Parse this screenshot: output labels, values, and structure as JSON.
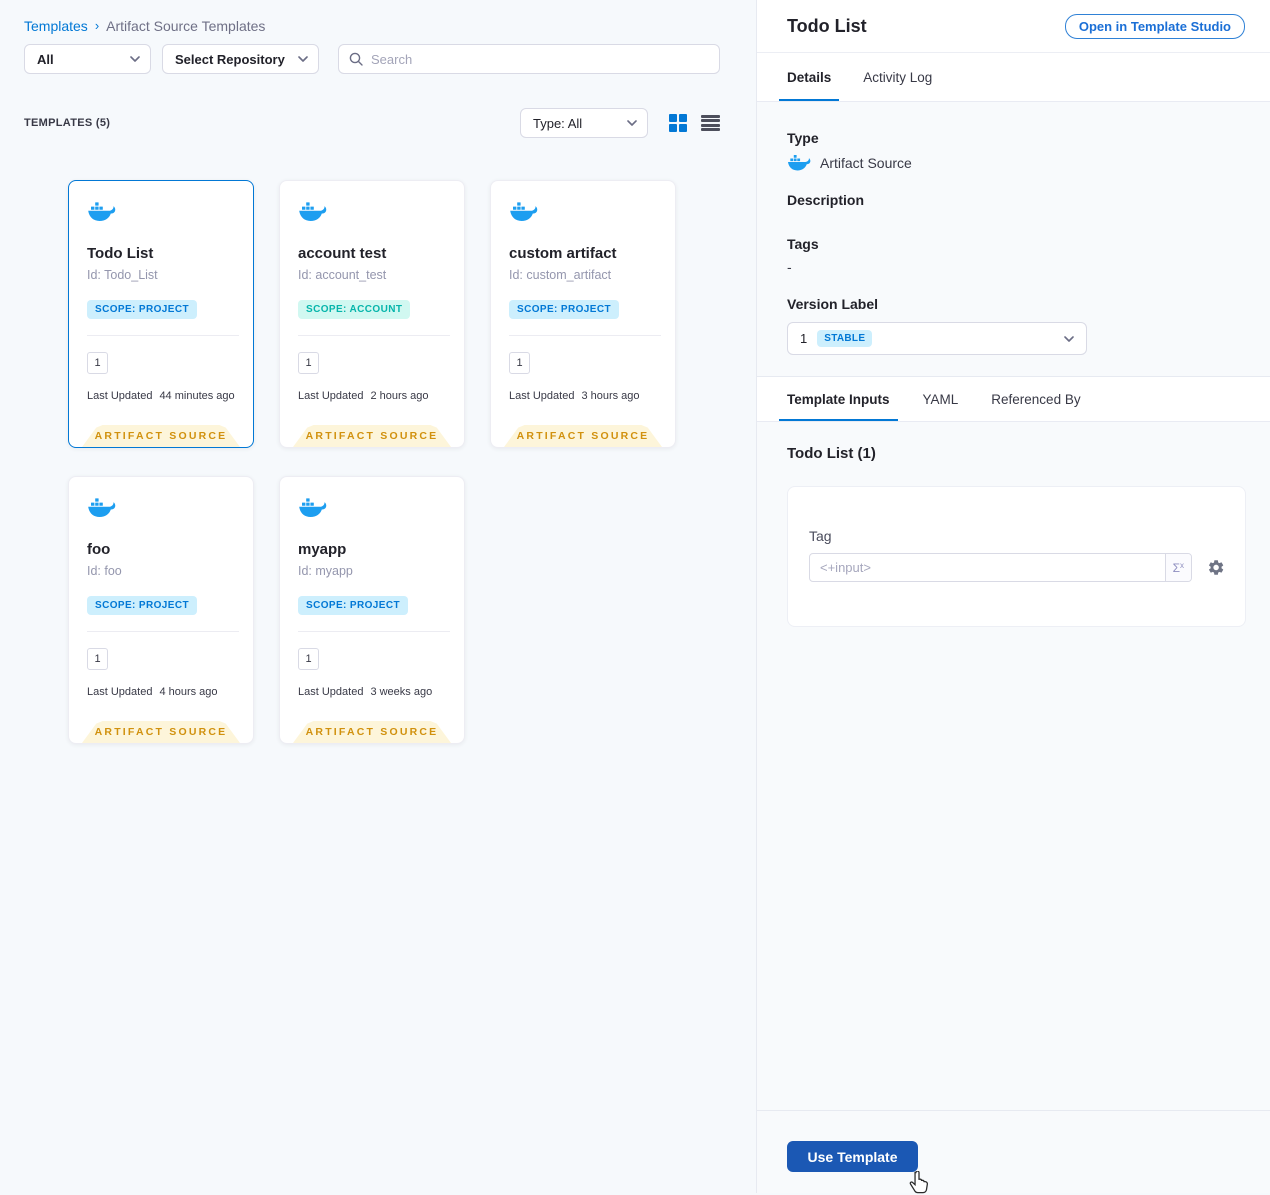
{
  "breadcrumb": {
    "root": "Templates",
    "separator": "›",
    "current": "Artifact Source Templates"
  },
  "filters": {
    "scope_value": "All",
    "repository_value": "Select Repository",
    "search_placeholder": "Search"
  },
  "list_header": {
    "count_label": "TEMPLATES (5)",
    "type_filter_value": "Type: All"
  },
  "cards": [
    {
      "name": "Todo List",
      "id": "Id: Todo_List",
      "scope": "SCOPE: PROJECT",
      "scope_kind": "project",
      "version": "1",
      "updated_label": "Last Updated",
      "updated": "44 minutes ago",
      "footer": "ARTIFACT SOURCE",
      "selected": true
    },
    {
      "name": "account test",
      "id": "Id: account_test",
      "scope": "SCOPE: ACCOUNT",
      "scope_kind": "account",
      "version": "1",
      "updated_label": "Last Updated",
      "updated": "2 hours ago",
      "footer": "ARTIFACT SOURCE",
      "selected": false
    },
    {
      "name": "custom artifact",
      "id": "Id: custom_artifact",
      "scope": "SCOPE: PROJECT",
      "scope_kind": "project",
      "version": "1",
      "updated_label": "Last Updated",
      "updated": "3 hours ago",
      "footer": "ARTIFACT SOURCE",
      "selected": false
    },
    {
      "name": "foo",
      "id": "Id: foo",
      "scope": "SCOPE: PROJECT",
      "scope_kind": "project",
      "version": "1",
      "updated_label": "Last Updated",
      "updated": "4 hours ago",
      "footer": "ARTIFACT SOURCE",
      "selected": false
    },
    {
      "name": "myapp",
      "id": "Id: myapp",
      "scope": "SCOPE: PROJECT",
      "scope_kind": "project",
      "version": "1",
      "updated_label": "Last Updated",
      "updated": "3 weeks ago",
      "footer": "ARTIFACT SOURCE",
      "selected": false
    }
  ],
  "panel": {
    "title": "Todo List",
    "open_button": "Open in Template Studio",
    "tabs": {
      "details": "Details",
      "activity_log": "Activity Log"
    },
    "details": {
      "type_label": "Type",
      "type_value": "Artifact Source",
      "description_label": "Description",
      "tags_label": "Tags",
      "tags_value": "-",
      "version_label": "Version Label",
      "version_value": "1",
      "version_badge": "STABLE"
    },
    "sub_tabs": {
      "template_inputs": "Template Inputs",
      "yaml": "YAML",
      "referenced_by": "Referenced By"
    },
    "inputs": {
      "heading": "Todo List (1)",
      "tag_label": "Tag",
      "tag_placeholder": "<+input>"
    },
    "use_button": "Use Template"
  }
}
